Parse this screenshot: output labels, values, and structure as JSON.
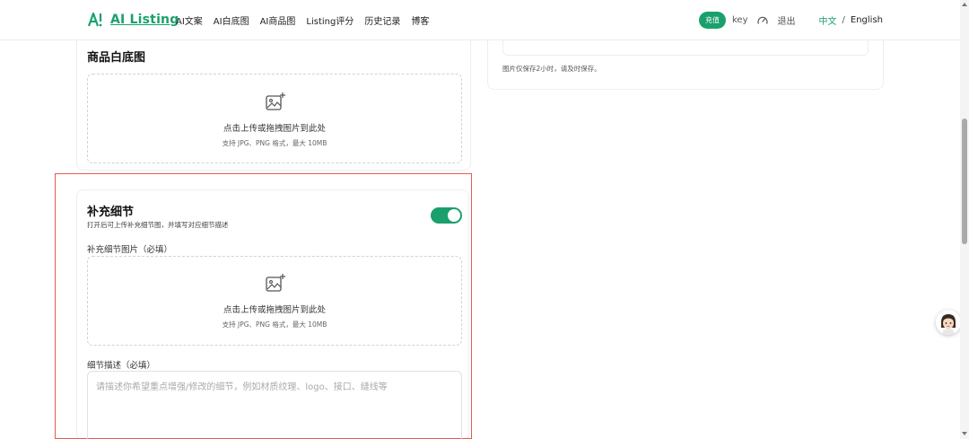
{
  "header": {
    "logo_text": "AI Listing",
    "nav": [
      "AI文案",
      "AI白底图",
      "AI商品图",
      "Listing评分",
      "历史记录",
      "博客"
    ],
    "recharge_label": "充值",
    "key_label": "key",
    "logout_label": "退出",
    "lang_zh": "中文",
    "lang_sep": "/",
    "lang_en": "English"
  },
  "white_bg": {
    "title": "商品白底图",
    "upload_text": "点击上传或拖拽图片到此处",
    "upload_hint": "支持 JPG、PNG 格式，最大 10MB"
  },
  "details": {
    "title": "补充细节",
    "description": "打开后可上传补充细节图，并填写对应细节描述",
    "toggle_on": true,
    "image_label": "补充细节图片（必填）",
    "upload_text": "点击上传或拖拽图片到此处",
    "upload_hint": "支持 JPG、PNG 格式，最大 10MB",
    "desc_label": "细节描述（必填）",
    "desc_placeholder": "请描述你希望重点增强/修改的细节，例如材质纹理、logo、接口、缝线等"
  },
  "right_panel": {
    "note": "图片仅保存2小时，请及时保存。"
  },
  "colors": {
    "accent": "#1aa06d",
    "highlight_border": "#e55a50"
  }
}
